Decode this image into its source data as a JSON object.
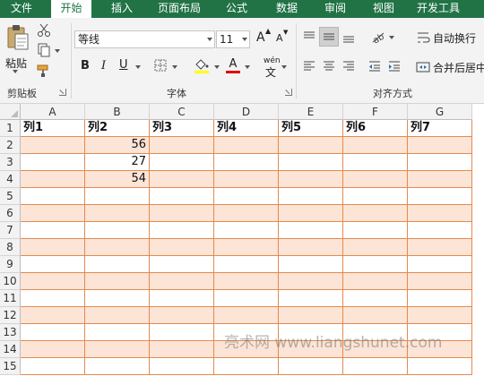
{
  "tabs": [
    {
      "label": "文件",
      "active": false
    },
    {
      "label": "开始",
      "active": true
    },
    {
      "label": "插入",
      "active": false
    },
    {
      "label": "页面布局",
      "active": false
    },
    {
      "label": "公式",
      "active": false
    },
    {
      "label": "数据",
      "active": false
    },
    {
      "label": "审阅",
      "active": false
    },
    {
      "label": "视图",
      "active": false
    },
    {
      "label": "开发工具",
      "active": false
    }
  ],
  "ribbon": {
    "clipboard": {
      "paste_label": "粘贴",
      "group_label": "剪贴板"
    },
    "font": {
      "font_name": "等线",
      "font_size": "11",
      "group_label": "字体",
      "bold": "B",
      "italic": "I",
      "underline": "U",
      "increase": "A",
      "decrease": "A",
      "font_color": "A",
      "phonetic": "wén"
    },
    "alignment": {
      "wrap_text": "自动换行",
      "merge_center": "合并后居中",
      "group_label": "对齐方式"
    }
  },
  "colors": {
    "accent": "#217346",
    "band": "#fce4d6",
    "border": "#e38b4f"
  },
  "sheet": {
    "columns": [
      "A",
      "B",
      "C",
      "D",
      "E",
      "F",
      "G"
    ],
    "rows": [
      [
        "列1",
        "列2",
        "列3",
        "列4",
        "列5",
        "列6",
        "列7"
      ],
      [
        "",
        "56",
        "",
        "",
        "",
        "",
        ""
      ],
      [
        "",
        "27",
        "",
        "",
        "",
        "",
        ""
      ],
      [
        "",
        "54",
        "",
        "",
        "",
        "",
        ""
      ],
      [
        "",
        "",
        "",
        "",
        "",
        "",
        ""
      ],
      [
        "",
        "",
        "",
        "",
        "",
        "",
        ""
      ],
      [
        "",
        "",
        "",
        "",
        "",
        "",
        ""
      ],
      [
        "",
        "",
        "",
        "",
        "",
        "",
        ""
      ],
      [
        "",
        "",
        "",
        "",
        "",
        "",
        ""
      ],
      [
        "",
        "",
        "",
        "",
        "",
        "",
        ""
      ],
      [
        "",
        "",
        "",
        "",
        "",
        "",
        ""
      ],
      [
        "",
        "",
        "",
        "",
        "",
        "",
        ""
      ],
      [
        "",
        "",
        "",
        "",
        "",
        "",
        ""
      ],
      [
        "",
        "",
        "",
        "",
        "",
        "",
        ""
      ],
      [
        "",
        "",
        "",
        "",
        "",
        "",
        ""
      ]
    ],
    "row_numbers": [
      "1",
      "2",
      "3",
      "4",
      "5",
      "6",
      "7",
      "8",
      "9",
      "10",
      "11",
      "12",
      "13",
      "14",
      "15"
    ]
  },
  "watermark": "亮术网 www.liangshunet.com"
}
